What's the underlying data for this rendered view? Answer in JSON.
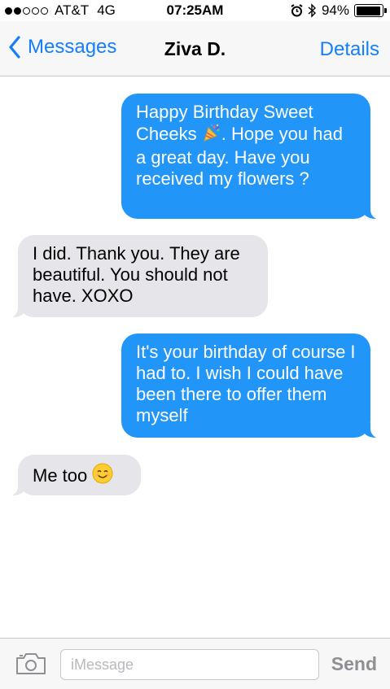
{
  "status_bar": {
    "carrier": "AT&T",
    "network": "4G",
    "time": "07:25AM",
    "battery_text": "94%",
    "battery_level": 0.94,
    "signal_bars_filled": 2,
    "signal_bars_total": 5,
    "icons": [
      "alarm-icon",
      "bluetooth-icon",
      "battery-icon"
    ]
  },
  "nav": {
    "back_label": "Messages",
    "title": "Ziva D.",
    "details_label": "Details"
  },
  "messages": [
    {
      "direction": "outgoing",
      "text_before": "Happy Birthday Sweet Cheeks ",
      "emoji": "party-popper",
      "text_after": ". Hope you had a great day. Have you received my flowers ?"
    },
    {
      "direction": "incoming",
      "text": "I did. Thank you. They are beautiful. You should not have. XOXO"
    },
    {
      "direction": "outgoing",
      "text": "It's your birthday of course I had to. I wish I could have been there to offer them myself"
    },
    {
      "direction": "incoming",
      "text": "Me too ",
      "emoji": "smiling-face"
    }
  ],
  "input_bar": {
    "placeholder": "iMessage",
    "value": "",
    "send_label": "Send"
  },
  "colors": {
    "accent": "#157efb",
    "outgoing_bubble": "#2196f8",
    "incoming_bubble": "#e5e5ea",
    "bar_background": "#f7f7f8",
    "send_disabled": "#8e8e93"
  }
}
